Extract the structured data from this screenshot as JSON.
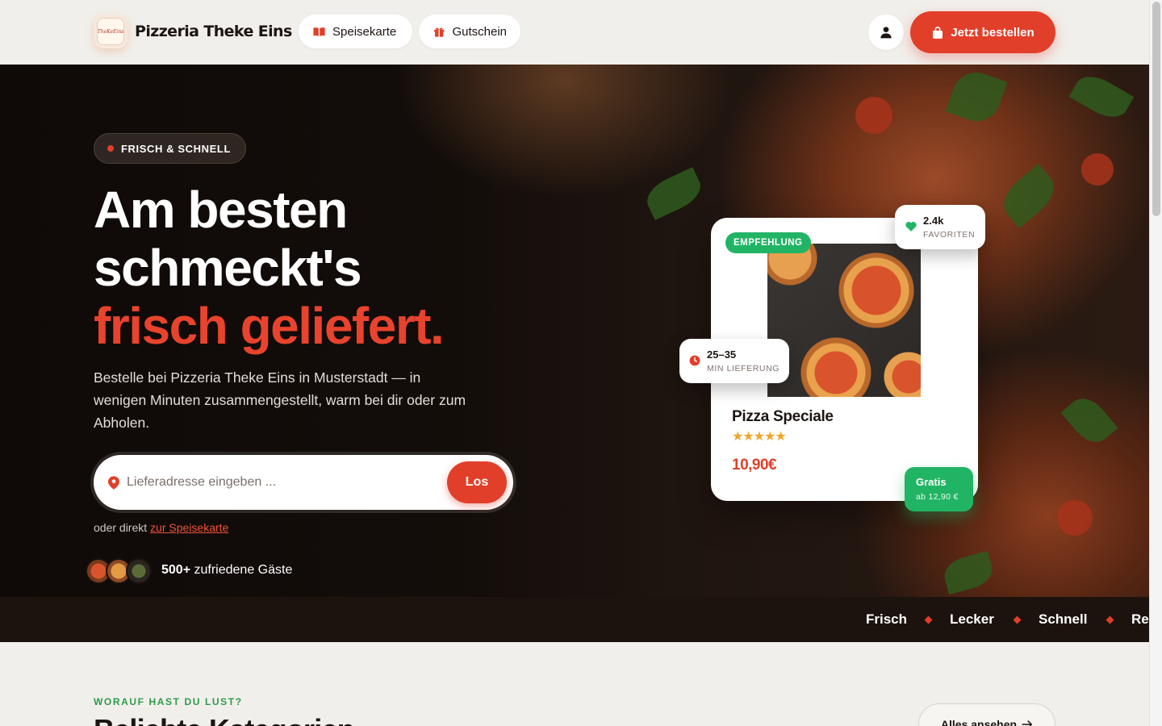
{
  "header": {
    "logo_text": "TheKeEins",
    "brand": "Pizzeria Theke Eins",
    "nav": [
      {
        "label": "Speisekarte",
        "icon": "book-icon"
      },
      {
        "label": "Gutschein",
        "icon": "gift-icon"
      }
    ],
    "user_icon": "user-icon",
    "order_label": "Jetzt bestellen",
    "order_icon": "shopping-bag-icon"
  },
  "hero": {
    "badge": "FRISCH & SCHNELL",
    "headline": [
      "Am besten",
      "schmeckt's",
      "frisch geliefert."
    ],
    "lead": "Bestelle bei Pizzeria Theke Eins in Musterstadt — in wenigen Minuten zusammengestellt, warm bei dir oder zum Abholen.",
    "search": {
      "placeholder": "Lieferadresse eingeben ...",
      "value": "",
      "button": "Los"
    },
    "alt_prefix": "oder direkt",
    "alt_link": "zur Speisekarte",
    "guests_count": "500+",
    "guests_text": "zufriedene Gäste"
  },
  "product_card": {
    "tag": "EMPFEHLUNG",
    "name": "Pizza Speciale",
    "rating": 5,
    "stars": "★★★★★",
    "price": "10,90€",
    "favorites": {
      "value": "2.4k",
      "label": "FAVORITEN"
    },
    "delivery": {
      "value": "25–35",
      "label": "MIN LIEFERUNG"
    },
    "free": {
      "title": "Gratis",
      "sub": "ab 12,90 €"
    }
  },
  "marquee": [
    "Frisch",
    "Lecker",
    "Schnell",
    "Re"
  ],
  "section": {
    "kicker": "WORAUF HAST DU LUST?",
    "title": "Beliebte Kategorien",
    "all_label": "Alles ansehen",
    "all_icon": "arrow-right-icon"
  },
  "colors": {
    "accent": "#e23f2a",
    "green": "#22b465",
    "dark": "#1d130e",
    "background": "#f1efeb"
  }
}
